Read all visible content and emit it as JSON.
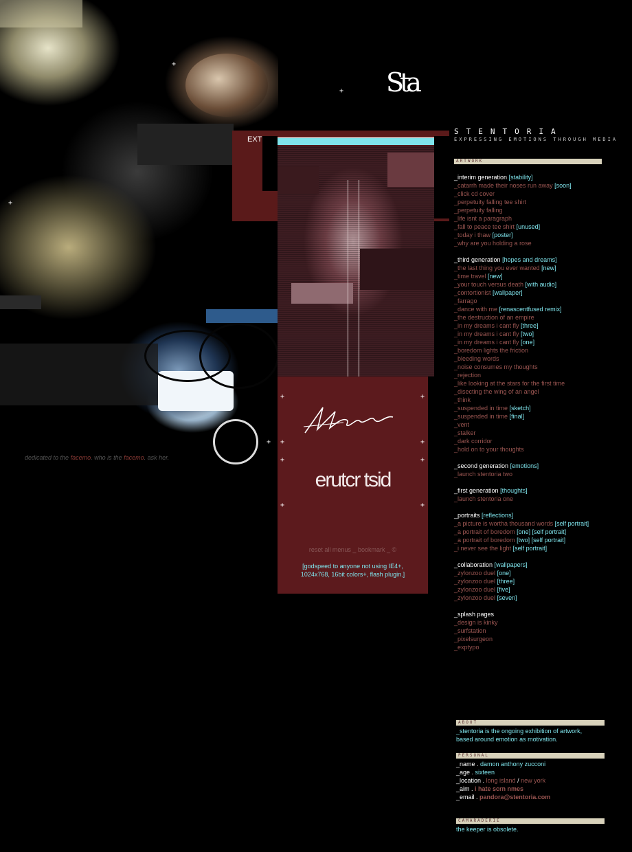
{
  "brand": {
    "name": "STENTORIA",
    "tagline": "EXPRESSING EMOTIONS THROUGH MEDIA",
    "logo_text": "Sta"
  },
  "art": {
    "ext_label": "EXT",
    "dedication": {
      "prefix": "dedicated to the ",
      "facemo1": "facemo",
      "middle": ". who is the ",
      "facemo2": "facemo",
      "suffix": ". ask her."
    },
    "title": "erutcr tsid"
  },
  "footer": {
    "reset": "reset all menus",
    "sep1": " _ ",
    "bookmark": "bookmark",
    "sep2": " _ ",
    "copyright": "©",
    "requirements_line1": "[godspeed to anyone not using IE4+,",
    "requirements_line2": "1024x768, 16bit colors+, flash plugin.]"
  },
  "sections": {
    "artwork": "ARTWORK",
    "about": "ABOUT",
    "personal": "PERSONAL",
    "camaraderie": "CAMARADERIE"
  },
  "menu": {
    "interim": {
      "head": "_interim generation",
      "tag": "[stability]",
      "items": [
        {
          "label": "_catarrh made their noses run away",
          "tag": "[soon]"
        },
        {
          "label": "_click cd cover",
          "tag": ""
        },
        {
          "label": "_perpetuity falling tee shirt",
          "tag": ""
        },
        {
          "label": "_perpetuity falling",
          "tag": ""
        },
        {
          "label": "_life isnt a paragraph",
          "tag": ""
        },
        {
          "label": "_fall to peace tee shirt",
          "tag": "[unused]"
        },
        {
          "label": "_today i thaw",
          "tag": "[poster]"
        },
        {
          "label": "_why are you holding a rose",
          "tag": ""
        }
      ]
    },
    "third": {
      "head": "_third generation",
      "tag": "[hopes and dreams]",
      "items": [
        {
          "label": "_the last thing you ever wanted",
          "tag": "[new]"
        },
        {
          "label": "_time travel",
          "tag": "[new]"
        },
        {
          "label": "_your touch versus death",
          "tag": "[with audio]"
        },
        {
          "label": "_contortionist",
          "tag": "[wallpaper]"
        },
        {
          "label": "_farrago",
          "tag": ""
        },
        {
          "label": "_dance with me",
          "tag": "[renascentfused remix]"
        },
        {
          "label": "_the destruction of an empire",
          "tag": ""
        },
        {
          "label": "_in my dreams i cant fly",
          "tag": "[three]"
        },
        {
          "label": "_in my dreams i cant fly",
          "tag": "[two]"
        },
        {
          "label": "_in my dreams i cant fly",
          "tag": "[one]"
        },
        {
          "label": "_boredom lights the friction",
          "tag": ""
        },
        {
          "label": "_bleeding words",
          "tag": ""
        },
        {
          "label": "_noise consumes my thoughts",
          "tag": ""
        },
        {
          "label": "_rejection",
          "tag": ""
        },
        {
          "label": "_like looking at the stars for the first time",
          "tag": ""
        },
        {
          "label": "_disecting the wing of an angel",
          "tag": ""
        },
        {
          "label": "_think",
          "tag": ""
        },
        {
          "label": "_suspended in time",
          "tag": "[sketch]"
        },
        {
          "label": "_suspended in time",
          "tag": "[final]"
        },
        {
          "label": "_vent",
          "tag": ""
        },
        {
          "label": "_stalker",
          "tag": ""
        },
        {
          "label": "_dark corridor",
          "tag": ""
        },
        {
          "label": "_hold on to your thoughts",
          "tag": ""
        }
      ]
    },
    "second": {
      "head": "_second generation",
      "tag": "[emotions]",
      "items": [
        {
          "label": "_launch stentoria two",
          "tag": ""
        }
      ]
    },
    "first": {
      "head": "_first generation",
      "tag": "[thoughts]",
      "items": [
        {
          "label": "_launch stentoria one",
          "tag": ""
        }
      ]
    },
    "portraits": {
      "head": "_portraits",
      "tag": "[reflections]",
      "items": [
        {
          "label": "_a picture is wortha thousand words",
          "tag": "[self portrait]"
        },
        {
          "label": "_a portrait of boredom",
          "tag": "[one] [self portrait]"
        },
        {
          "label": "_a portrait of boredom",
          "tag": "[two] [self portrait]"
        },
        {
          "label": "_i never see the light",
          "tag": "[self portrait]"
        }
      ]
    },
    "collaboration": {
      "head": "_collaboration",
      "tag": "[wallpapers]",
      "items": [
        {
          "label": "_zylonzoo duel",
          "tag": "[one]"
        },
        {
          "label": "_zylonzoo duel",
          "tag": "[three]"
        },
        {
          "label": "_zylonzoo duel",
          "tag": "[five]"
        },
        {
          "label": "_zylonzoo duel",
          "tag": "[seven]"
        }
      ]
    },
    "splash": {
      "head": "_splash pages",
      "tag": "",
      "items": [
        {
          "label": "_design is kinky",
          "tag": ""
        },
        {
          "label": "_surfstation",
          "tag": ""
        },
        {
          "label": "_pixelsurgeon",
          "tag": ""
        },
        {
          "label": "_exptypo",
          "tag": ""
        }
      ]
    }
  },
  "about": {
    "line1": "_stentoria is the ongoing exhibition of artwork,",
    "line2": "based around emotion as motivation."
  },
  "personal": {
    "name_k": "_name . ",
    "name_v": "damon anthony zucconi",
    "age_k": "_age . ",
    "age_v": "sixteen",
    "location_k": "_location . ",
    "location_v1": "long island",
    "location_sep": " / ",
    "location_v2": "new york",
    "aim_k": "_aim . ",
    "aim_v": "i hate scrn nmes",
    "email_k": "_email . ",
    "email_v": "pandora@stentoria.com"
  },
  "camaraderie": {
    "text": "the keeper is obsolete."
  },
  "colors": {
    "accent_cyan": "#7fe4ec",
    "maroon": "#5c1a1d",
    "muted_red": "#9a5551",
    "header_bar": "#d8d2bb"
  }
}
